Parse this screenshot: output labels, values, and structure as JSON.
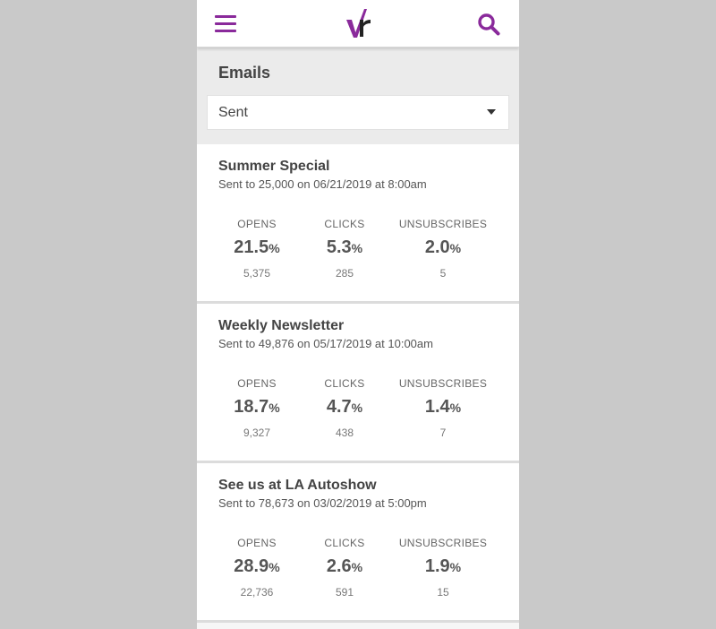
{
  "header": {
    "menu_icon": "hamburger-icon",
    "logo_icon": "vr-logo",
    "search_icon": "search-icon",
    "accent_color": "#8a2a9b"
  },
  "section": {
    "title": "Emails",
    "filter": {
      "value": "Sent"
    }
  },
  "emails": [
    {
      "title": "Summer Special",
      "subtitle": "Sent to 25,000 on 06/21/2019 at 8:00am",
      "stats": [
        {
          "label": "OPENS",
          "pct": "21.5",
          "count": "5,375"
        },
        {
          "label": "CLICKS",
          "pct": "5.3",
          "count": "285"
        },
        {
          "label": "UNSUBSCRIBES",
          "pct": "2.0",
          "count": "5"
        }
      ]
    },
    {
      "title": "Weekly Newsletter",
      "subtitle": "Sent to 49,876 on 05/17/2019 at 10:00am",
      "stats": [
        {
          "label": "OPENS",
          "pct": "18.7",
          "count": "9,327"
        },
        {
          "label": "CLICKS",
          "pct": "4.7",
          "count": "438"
        },
        {
          "label": "UNSUBSCRIBES",
          "pct": "1.4",
          "count": "7"
        }
      ]
    },
    {
      "title": "See us at LA Autoshow",
      "subtitle": "Sent to 78,673 on 03/02/2019 at 5:00pm",
      "stats": [
        {
          "label": "OPENS",
          "pct": "28.9",
          "count": "22,736"
        },
        {
          "label": "CLICKS",
          "pct": "2.6",
          "count": "591"
        },
        {
          "label": "UNSUBSCRIBES",
          "pct": "1.9",
          "count": "15"
        }
      ]
    }
  ],
  "pct_symbol": "%"
}
